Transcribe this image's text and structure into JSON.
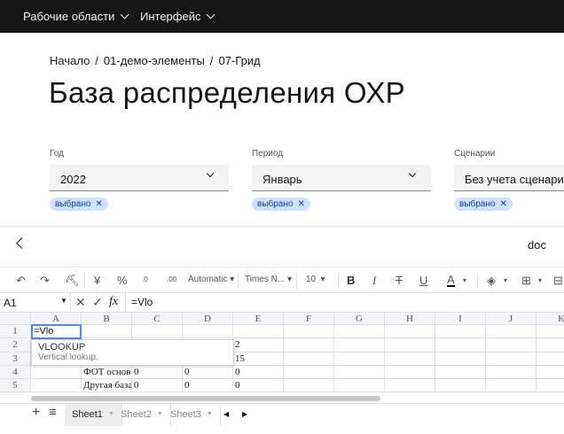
{
  "topbar": {
    "menus": [
      {
        "label": "Рабочие области"
      },
      {
        "label": "Интерфейс"
      }
    ]
  },
  "breadcrumb": {
    "items": [
      "Начало",
      "01-демо-элементы",
      "07-Грид"
    ],
    "separator": "/"
  },
  "page_title": "База распределения ОХР",
  "filters": [
    {
      "label": "Год",
      "value": "2022",
      "tag": "выбрано"
    },
    {
      "label": "Период",
      "value": "Январь",
      "tag": "выбрано"
    },
    {
      "label": "Сценарии",
      "value": "Без учета сценария",
      "tag": "выбрано"
    }
  ],
  "panel": {
    "title": "doc"
  },
  "toolbar": {
    "format": "Automatic",
    "font": "Times N...",
    "size": "10",
    "currency": "¥",
    "percent": "%"
  },
  "formula_bar": {
    "cell_ref": "A1",
    "formula": "=Vlo",
    "fx": "fx"
  },
  "grid": {
    "columns": [
      "A",
      "B",
      "C",
      "D",
      "E",
      "F",
      "G",
      "H",
      "I",
      "J",
      "K"
    ],
    "rows": [
      "1",
      "2",
      "3",
      "4",
      "5"
    ],
    "cells": {
      "E2": "2",
      "E3": "15",
      "B4": "ФОТ основ",
      "C4": "0",
      "D4": "0",
      "E4": "0",
      "B5": "Другая база",
      "C5": "0",
      "D5": "0",
      "E5": "0"
    },
    "editing": "=Vlo"
  },
  "autocomplete": {
    "name": "VLOOKUP",
    "description": "Vertical lookup."
  },
  "sheets": [
    "Sheet1",
    "Sheet2",
    "Sheet3"
  ],
  "active_sheet": "Sheet1",
  "colors": {
    "topbar": "#161616",
    "tag_bg": "#d0e2ff",
    "tag_text": "#0043ce",
    "selection": "#4b89ff"
  }
}
